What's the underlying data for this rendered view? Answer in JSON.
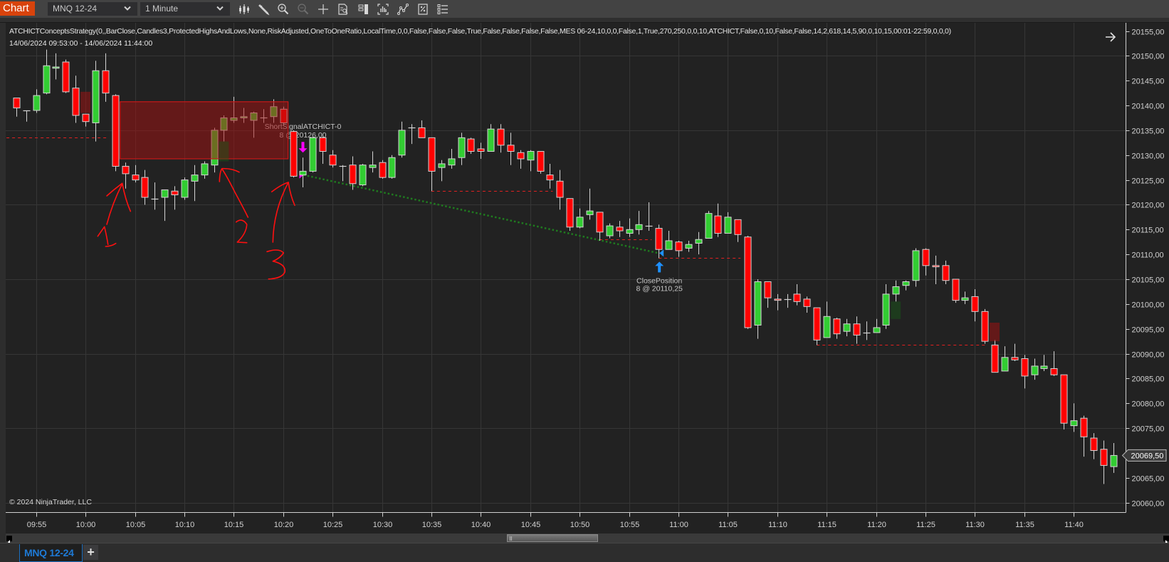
{
  "toolbar": {
    "chart_tab": "Chart",
    "instrument": "MNQ 12-24",
    "interval": "1 Minute",
    "tools": [
      "bar-type",
      "drawing-tools",
      "zoom-in",
      "zoom-out",
      "crosshair",
      "data-box",
      "chart-trader",
      "snapshot",
      "strategies",
      "templates",
      "indicators"
    ]
  },
  "chart": {
    "strategy_label": "ATCHICTConceptsStrategy(0,,BarClose,Candles3,ProtectedHighsAndLows,None,RiskAdjusted,OneToOneRatio,LocalTime,0,0,False,False,False,True,False,False,False,False,MES 06-24,10,0,0,False,1,True,270,250,0,0,10,ATCHICT,False,0,10,False,False,14,2,618,14,5,90,0,10,15,00:01-22:59,0,0,0)",
    "date_range": "14/06/2024 09:53:00 - 14/06/2024 11:44:00",
    "copyright": "© 2024 NinjaTrader, LLC",
    "last_price_label": "20069,50"
  },
  "bottom_tabs": {
    "active_tab": "MNQ 12-24",
    "add_tab": "+"
  },
  "chart_data": {
    "type": "bar",
    "subtype": "candlestick",
    "title": "MNQ 12-24",
    "interval": "1 Minute",
    "xlabel": "",
    "ylabel": "",
    "grid": true,
    "xlim": [
      "09:52",
      "11:45"
    ],
    "ylim": [
      20058,
      20156.5
    ],
    "colors": {
      "up": "#32cd32",
      "down": "#ff0000",
      "outline": "#d4d4d4",
      "entry": "#ff00ff",
      "exit": "#1e90ff",
      "level": "#e02020",
      "trade_line": "#1f7a1f",
      "annotation": "#ff1010"
    },
    "yticks": [
      "20155,00",
      "20150,00",
      "20145,00",
      "20140,00",
      "20135,00",
      "20130,00",
      "20125,00",
      "20120,00",
      "20115,00",
      "20110,00",
      "20105,00",
      "20100,00",
      "20095,00",
      "20090,00",
      "20085,00",
      "20080,00",
      "20075,00",
      "20070,00",
      "20065,00",
      "20060,00"
    ],
    "xticks": [
      "09:55",
      "10:00",
      "10:05",
      "10:10",
      "10:15",
      "10:20",
      "10:25",
      "10:30",
      "10:35",
      "10:40",
      "10:45",
      "10:50",
      "10:55",
      "11:00",
      "11:05",
      "11:10",
      "11:15",
      "11:20",
      "11:25",
      "11:30",
      "11:35",
      "11:40"
    ],
    "candle_fields": [
      "time",
      "open",
      "high",
      "low",
      "close"
    ],
    "candles": [
      [
        "09:53",
        20141.5,
        20141.5,
        20137.75,
        20139.5
      ],
      [
        "09:54",
        20139,
        20139,
        20136.75,
        20139
      ],
      [
        "09:55",
        20139,
        20143.25,
        20138.5,
        20142
      ],
      [
        "09:56",
        20142.5,
        20151.25,
        20142.25,
        20148
      ],
      [
        "09:57",
        20147.5,
        20150.5,
        20145.25,
        20147.75
      ],
      [
        "09:58",
        20148.75,
        20149.25,
        20142.5,
        20142.75
      ],
      [
        "09:59",
        20143.5,
        20146,
        20136.5,
        20138
      ],
      [
        "10:00",
        20138.25,
        20138.25,
        20135.75,
        20136.75
      ],
      [
        "10:01",
        20136.5,
        20149,
        20132.75,
        20147
      ],
      [
        "10:02",
        20147,
        20150.5,
        20140.75,
        20142.5
      ],
      [
        "10:03",
        20142,
        20142.25,
        20126.75,
        20127.75
      ],
      [
        "10:04",
        20127.75,
        20128.5,
        20123.25,
        20126.25
      ],
      [
        "10:05",
        20126,
        20128,
        20124.5,
        20125
      ],
      [
        "10:06",
        20125.5,
        20127,
        20120,
        20121.5
      ],
      [
        "10:07",
        20121.25,
        20124.5,
        20119,
        20121.25
      ],
      [
        "10:08",
        20121.5,
        20123,
        20116.75,
        20123
      ],
      [
        "10:09",
        20122.75,
        20123.75,
        20119,
        20122
      ],
      [
        "10:10",
        20121.5,
        20125.5,
        20121,
        20125
      ],
      [
        "10:11",
        20124.75,
        20128,
        20120.75,
        20126
      ],
      [
        "10:12",
        20126,
        20128.75,
        20125.25,
        20128.25
      ],
      [
        "10:13",
        20128,
        20135.5,
        20126.5,
        20135
      ],
      [
        "10:14",
        20135,
        20138,
        20132.75,
        20137.5
      ],
      [
        "10:15",
        20137,
        20141.75,
        20136.5,
        20137.5
      ],
      [
        "10:16",
        20137.5,
        20139.5,
        20136.5,
        20137.75
      ],
      [
        "10:17",
        20137,
        20138.75,
        20133.5,
        20138.5
      ],
      [
        "10:18",
        20137.5,
        20139.25,
        20136.5,
        20137.5
      ],
      [
        "10:19",
        20137.75,
        20141.25,
        20136.5,
        20139.75
      ],
      [
        "10:20",
        20139.25,
        20139.75,
        20136,
        20136.5
      ],
      [
        "10:21",
        20134.75,
        20135,
        20125.5,
        20125.75
      ],
      [
        "10:22",
        20126,
        20129.5,
        20123.5,
        20126.75
      ],
      [
        "10:23",
        20126.75,
        20133.75,
        20126.5,
        20133.5
      ],
      [
        "10:24",
        20133.5,
        20133.75,
        20128.25,
        20130.75
      ],
      [
        "10:25",
        20130,
        20131,
        20127.5,
        20128
      ],
      [
        "10:26",
        20127.75,
        20128,
        20124.75,
        20127.75
      ],
      [
        "10:27",
        20128,
        20129.75,
        20123,
        20124.25
      ],
      [
        "10:28",
        20124,
        20128.25,
        20123.75,
        20128
      ],
      [
        "10:29",
        20127.5,
        20130.75,
        20126.5,
        20128
      ],
      [
        "10:30",
        20128.5,
        20129,
        20125.25,
        20125.5
      ],
      [
        "10:31",
        20125.5,
        20130,
        20125.25,
        20129.5
      ],
      [
        "10:32",
        20130,
        20136.75,
        20129.5,
        20135
      ],
      [
        "10:33",
        20135.5,
        20136.25,
        20132.25,
        20135.5
      ],
      [
        "10:34",
        20135.5,
        20137,
        20133.5,
        20133.5
      ],
      [
        "10:35",
        20133.5,
        20133.5,
        20122.75,
        20126.75
      ],
      [
        "10:36",
        20127.5,
        20129,
        20124.75,
        20128.25
      ],
      [
        "10:37",
        20128,
        20131.25,
        20127.25,
        20129.25
      ],
      [
        "10:38",
        20129.5,
        20134.5,
        20128,
        20133.5
      ],
      [
        "10:39",
        20133.25,
        20133.5,
        20130.25,
        20130.75
      ],
      [
        "10:40",
        20131.25,
        20132.5,
        20129.25,
        20130.75
      ],
      [
        "10:41",
        20130.75,
        20136.25,
        20130.75,
        20135.25
      ],
      [
        "10:42",
        20135.25,
        20136.25,
        20130.5,
        20132
      ],
      [
        "10:43",
        20132,
        20134.5,
        20128,
        20130.75
      ],
      [
        "10:44",
        20130.5,
        20131,
        20127.25,
        20129.25
      ],
      [
        "10:45",
        20129,
        20131,
        20126.75,
        20130.75
      ],
      [
        "10:46",
        20130.75,
        20130.75,
        20126.25,
        20126.75
      ],
      [
        "10:47",
        20126,
        20128.25,
        20123.25,
        20125
      ],
      [
        "10:48",
        20124.75,
        20127,
        20119,
        20121.5
      ],
      [
        "10:49",
        20121.25,
        20121.25,
        20114.75,
        20115.5
      ],
      [
        "10:50",
        20115.5,
        20119.25,
        20115.25,
        20117.5
      ],
      [
        "10:51",
        20118,
        20123.25,
        20117,
        20118.75
      ],
      [
        "10:52",
        20118.5,
        20118.5,
        20112.75,
        20114.5
      ],
      [
        "10:53",
        20113.75,
        20116.25,
        20113.25,
        20115.75
      ],
      [
        "10:54",
        20115.5,
        20116.75,
        20113.5,
        20114.75
      ],
      [
        "10:55",
        20114.25,
        20117.25,
        20113.5,
        20115
      ],
      [
        "10:56",
        20115,
        20118.75,
        20114,
        20116
      ],
      [
        "10:57",
        20115.75,
        20120.5,
        20114.75,
        20115.75
      ],
      [
        "10:58",
        20115.25,
        20116,
        20109.25,
        20111
      ],
      [
        "10:59",
        20111,
        20114.75,
        20111,
        20112.75
      ],
      [
        "11:00",
        20112.5,
        20112.75,
        20109.5,
        20110.75
      ],
      [
        "11:01",
        20111.25,
        20112.75,
        20110.5,
        20112
      ],
      [
        "11:02",
        20112.25,
        20114.5,
        20110,
        20113
      ],
      [
        "11:03",
        20113.25,
        20118.75,
        20113.25,
        20118.25
      ],
      [
        "11:04",
        20117.75,
        20120.25,
        20113.5,
        20114.25
      ],
      [
        "11:05",
        20114.25,
        20118.5,
        20114.25,
        20117.5
      ],
      [
        "11:06",
        20117,
        20117,
        20112.5,
        20114
      ],
      [
        "11:07",
        20113.5,
        20113.75,
        20095,
        20095.25
      ],
      [
        "11:08",
        20095.75,
        20105,
        20093,
        20104.5
      ],
      [
        "11:09",
        20104.5,
        20104.5,
        20099.25,
        20101.25
      ],
      [
        "11:10",
        20101,
        20102,
        20098.75,
        20100.75
      ],
      [
        "11:11",
        20101,
        20102,
        20099.25,
        20101
      ],
      [
        "11:12",
        20102,
        20104,
        20099.75,
        20100.5
      ],
      [
        "11:13",
        20101,
        20101.5,
        20098.25,
        20099.5
      ],
      [
        "11:14",
        20099.25,
        20099.25,
        20091.75,
        20092.75
      ],
      [
        "11:15",
        20093.25,
        20100.5,
        20093.25,
        20097.5
      ],
      [
        "11:16",
        20097,
        20097.25,
        20093,
        20094
      ],
      [
        "11:17",
        20094.5,
        20097,
        20093.5,
        20096
      ],
      [
        "11:18",
        20096,
        20097.5,
        20092,
        20093.75
      ],
      [
        "11:19",
        20094.25,
        20096.5,
        20092.75,
        20094.25
      ],
      [
        "11:20",
        20094.25,
        20097,
        20094.25,
        20095.25
      ],
      [
        "11:21",
        20095.75,
        20104,
        20095,
        20102
      ],
      [
        "11:22",
        20102,
        20104.75,
        20100.5,
        20103.5
      ],
      [
        "11:23",
        20103.75,
        20104.75,
        20102.75,
        20104.5
      ],
      [
        "11:24",
        20104.75,
        20111.25,
        20103.5,
        20110.75
      ],
      [
        "11:25",
        20111,
        20111.25,
        20105.75,
        20107.75
      ],
      [
        "11:26",
        20107.75,
        20109.75,
        20104,
        20107.5
      ],
      [
        "11:27",
        20107.75,
        20108.75,
        20104,
        20104.75
      ],
      [
        "11:28",
        20105,
        20105,
        20100.25,
        20100.75
      ],
      [
        "11:29",
        20100.75,
        20102.5,
        20100,
        20101.25
      ],
      [
        "11:30",
        20101.5,
        20103,
        20096.5,
        20098.5
      ],
      [
        "11:31",
        20098.5,
        20099,
        20092,
        20092.5
      ],
      [
        "11:32",
        20091.75,
        20092.75,
        20086.25,
        20086.25
      ],
      [
        "11:33",
        20086.5,
        20091.5,
        20086.5,
        20089.25
      ],
      [
        "11:34",
        20089.25,
        20092,
        20088.5,
        20088.75
      ],
      [
        "11:35",
        20089,
        20089.75,
        20083,
        20085.5
      ],
      [
        "11:36",
        20085.75,
        20089,
        20084.75,
        20087.5
      ],
      [
        "11:37",
        20087,
        20089.75,
        20086.5,
        20087.5
      ],
      [
        "11:38",
        20087,
        20090.5,
        20085.5,
        20085.75
      ],
      [
        "11:39",
        20085.75,
        20085.75,
        20074.75,
        20076
      ],
      [
        "11:40",
        20075.5,
        20080,
        20074.25,
        20076.5
      ],
      [
        "11:41",
        20077,
        20077.5,
        20069.25,
        20073.25
      ],
      [
        "11:42",
        20073,
        20074,
        20068.75,
        20070.5
      ],
      [
        "11:43",
        20070.75,
        20072.5,
        20063.75,
        20067.5
      ],
      [
        "11:44",
        20067.25,
        20072,
        20066,
        20069.5
      ]
    ],
    "zones": [
      {
        "kind": "bearish",
        "start": "10:04",
        "end": "10:20",
        "top": 20140.75,
        "bottom": 20129.25,
        "outlined": true
      },
      {
        "kind": "bearish",
        "start": "10:00",
        "end": "10:00",
        "top": 20142.75,
        "bottom": 20138.5,
        "outlined": false
      },
      {
        "kind": "bullish",
        "start": "10:14",
        "end": "10:14",
        "top": 20132.75,
        "bottom": 20128.75,
        "outlined": false
      },
      {
        "kind": "bullish",
        "start": "11:22",
        "end": "11:22",
        "top": 20100.5,
        "bottom": 20097,
        "outlined": false
      },
      {
        "kind": "bearish",
        "start": "11:32",
        "end": "11:32",
        "top": 20096.25,
        "bottom": 20092.5,
        "outlined": false
      }
    ],
    "levels": [
      {
        "price": 20133.5,
        "start": "09:52",
        "end": "10:02"
      },
      {
        "price": 20122.75,
        "start": "10:35",
        "end": "10:47"
      },
      {
        "price": 20113,
        "start": "10:52",
        "end": "10:57"
      },
      {
        "price": 20109.25,
        "start": "10:58",
        "end": "11:06"
      },
      {
        "price": 20091.75,
        "start": "11:14",
        "end": "11:31"
      }
    ],
    "trades": [
      {
        "direction": "short",
        "entry": {
          "time": "10:22",
          "price": 20126,
          "label": "ShortSignalATCHICT-0",
          "detail": "8 @ 20126,00"
        },
        "exit": {
          "time": "10:58",
          "price": 20110.25,
          "label": "ClosePosition",
          "detail": "8 @ 20110,25"
        }
      }
    ],
    "annotations": [
      {
        "label": "1",
        "points_to": "10:04"
      },
      {
        "label": "2",
        "points_to": "10:13"
      },
      {
        "label": "3",
        "points_to": "10:21"
      }
    ],
    "last_price": 20069.5
  }
}
